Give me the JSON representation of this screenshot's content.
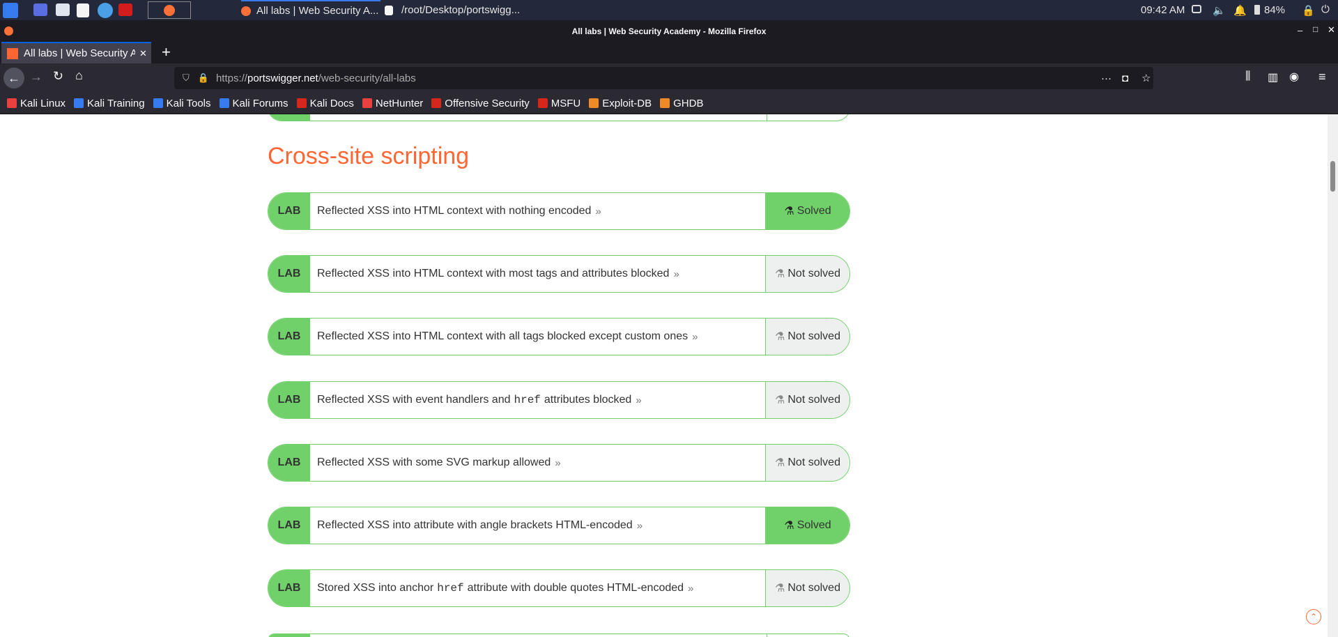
{
  "taskbar": {
    "window_buttons": [
      "All labs | Web Security A...",
      "/root/Desktop/portswigg..."
    ],
    "clock": "09:42 AM",
    "battery": "84%"
  },
  "window": {
    "title": "All labs | Web Security Academy - Mozilla Firefox"
  },
  "tab": {
    "label": "All labs | Web Security Ac",
    "close": "✕",
    "new": "+"
  },
  "url": {
    "scheme": "https://",
    "host": "portswigger.net",
    "path": "/web-security/all-labs"
  },
  "bookmarks": [
    {
      "label": "Kali Linux",
      "color": "#e94040"
    },
    {
      "label": "Kali Training",
      "color": "#367bf0"
    },
    {
      "label": "Kali Tools",
      "color": "#367bf0"
    },
    {
      "label": "Kali Forums",
      "color": "#367bf0"
    },
    {
      "label": "Kali Docs",
      "color": "#d7261b"
    },
    {
      "label": "NetHunter",
      "color": "#e94040"
    },
    {
      "label": "Offensive Security",
      "color": "#d7261b"
    },
    {
      "label": "MSFU",
      "color": "#d7261b"
    },
    {
      "label": "Exploit-DB",
      "color": "#f08a24"
    },
    {
      "label": "GHDB",
      "color": "#f08a24"
    }
  ],
  "section": {
    "title": "Cross-site scripting"
  },
  "labs": [
    {
      "tag": "LAB",
      "title": "Reflected XSS into HTML context with nothing encoded",
      "status": "Solved"
    },
    {
      "tag": "LAB",
      "title": "Reflected XSS into HTML context with most tags and attributes blocked",
      "status": "Not solved"
    },
    {
      "tag": "LAB",
      "title": "Reflected XSS into HTML context with all tags blocked except custom ones",
      "status": "Not solved"
    },
    {
      "tag": "LAB",
      "title_pre": "Reflected XSS with event handlers and",
      "code": "href",
      "title_post": "attributes blocked",
      "status": "Not solved"
    },
    {
      "tag": "LAB",
      "title": "Reflected XSS with some SVG markup allowed",
      "status": "Not solved"
    },
    {
      "tag": "LAB",
      "title": "Reflected XSS into attribute with angle brackets HTML-encoded",
      "status": "Solved"
    },
    {
      "tag": "LAB",
      "title_pre": "Stored XSS into anchor",
      "code": "href",
      "title_post": "attribute with double quotes HTML-encoded",
      "status": "Not solved"
    }
  ],
  "colors": {
    "accent": "#ff6633",
    "lab_green": "#70d16a"
  }
}
